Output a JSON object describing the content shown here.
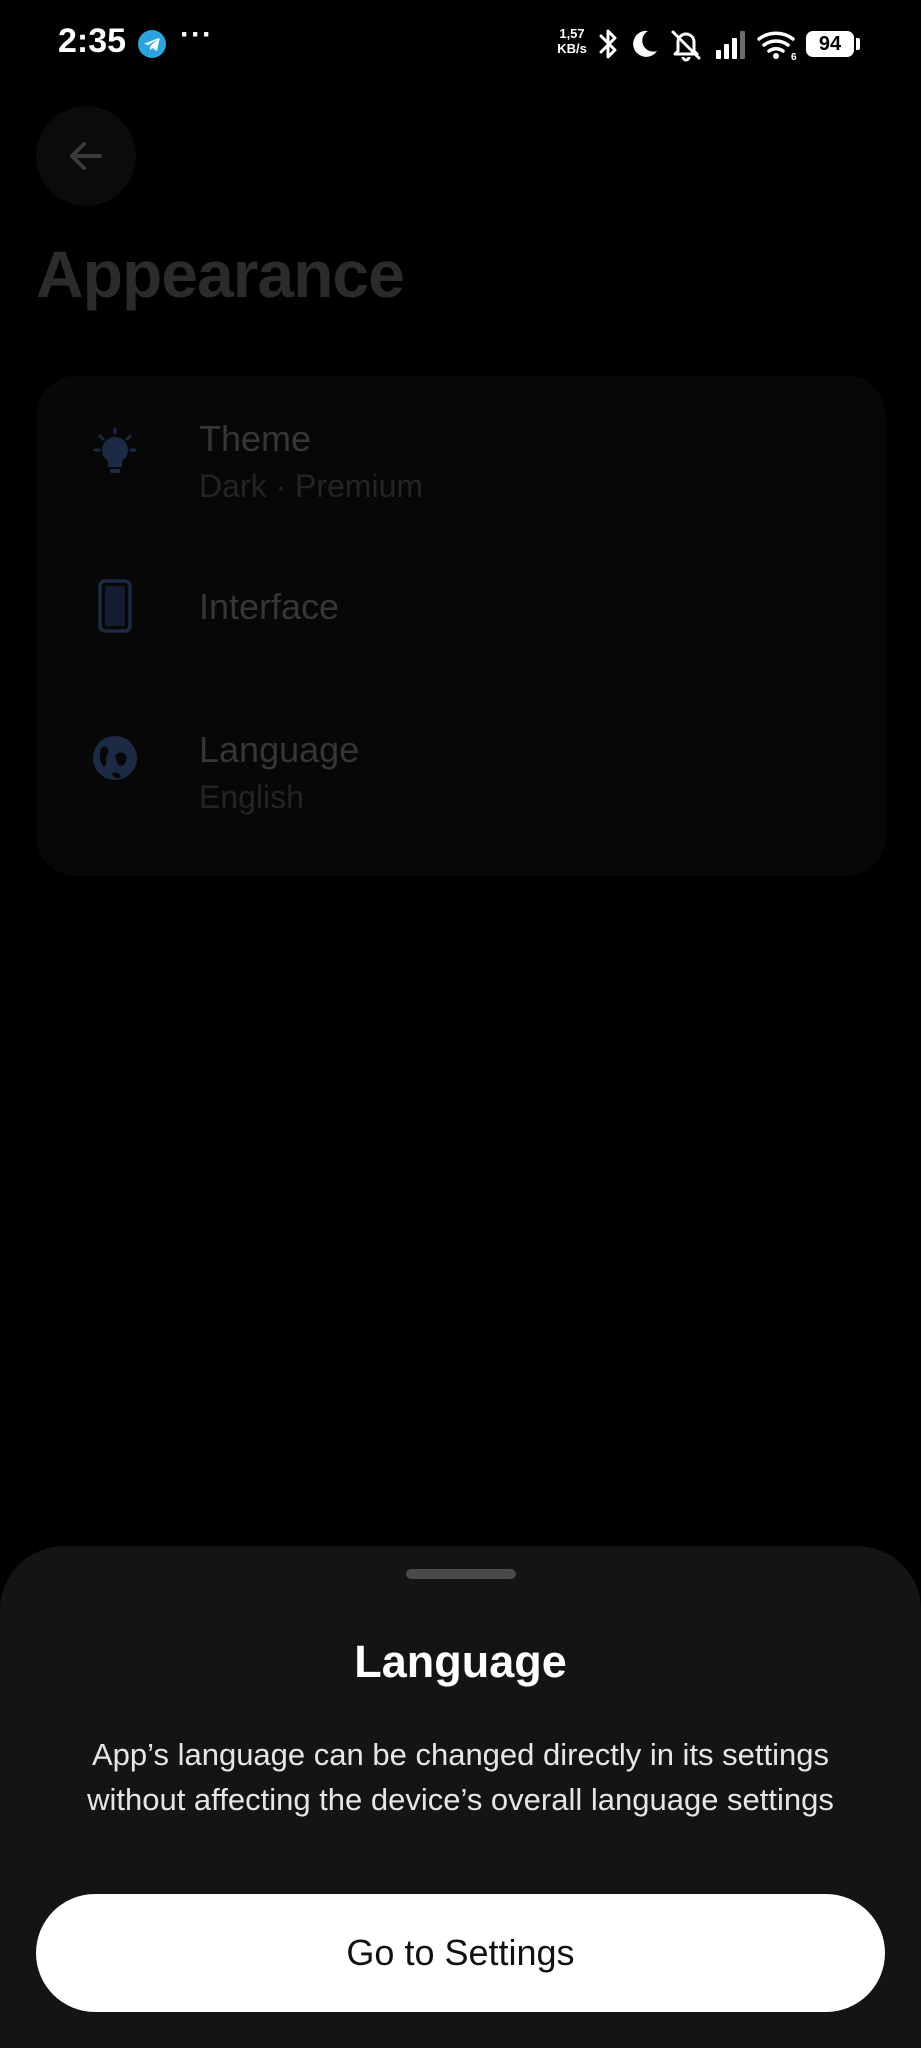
{
  "status_bar": {
    "time": "2:35",
    "more": "···",
    "speed_value": "1,57",
    "speed_unit": "KB/s",
    "battery": "94",
    "icons": [
      "telegram-icon",
      "bluetooth-icon",
      "moon-icon",
      "bell-off-icon",
      "signal-icon",
      "wifi-icon",
      "battery-icon"
    ]
  },
  "page": {
    "title": "Appearance",
    "back_icon": "arrow-left-icon",
    "items": [
      {
        "icon": "lightbulb-icon",
        "title": "Theme",
        "subtitle": "Dark · Premium"
      },
      {
        "icon": "phone-icon",
        "title": "Interface",
        "subtitle": ""
      },
      {
        "icon": "globe-icon",
        "title": "Language",
        "subtitle": "English"
      }
    ]
  },
  "sheet": {
    "title": "Language",
    "description_line1": "App’s language can be changed directly in its settings",
    "description_line2": "without affecting the device’s overall language settings",
    "button_label": "Go to Settings"
  },
  "colors": {
    "background": "#000000",
    "sheet": "#141414",
    "button": "#ffffff",
    "accent_telegram": "#2aa3de",
    "dim_icon_blue": "#1c2a45"
  }
}
